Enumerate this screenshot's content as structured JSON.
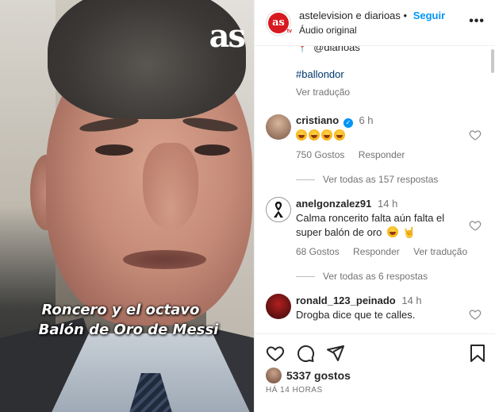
{
  "video": {
    "logo": "as",
    "caption_line1": "Roncero y el octavo",
    "caption_line2": "Balón de Oro de Messi"
  },
  "header": {
    "avatar_text": "as",
    "avatar_badge": "tv",
    "accounts": "astelevision e diarioas",
    "separator": "•",
    "follow": "Seguir",
    "audio": "Áudio original",
    "more": "•••"
  },
  "caption": {
    "tail": "@diarioas",
    "hashtag": "#ballondor",
    "translate": "Ver tradução"
  },
  "comments": [
    {
      "user": "cristiano",
      "verified": true,
      "time": "6 h",
      "text": "",
      "emoji_count": 4,
      "likes": "750 Gostos",
      "reply": "Responder",
      "translate": "",
      "view_replies": "Ver todas as 157 respostas"
    },
    {
      "user": "anelgonzalez91",
      "verified": false,
      "time": "14 h",
      "text": "Calma roncerito falta aún falta el super balón de oro",
      "likes": "68 Gostos",
      "reply": "Responder",
      "translate": "Ver tradução",
      "view_replies": "Ver todas as 6 respostas"
    },
    {
      "user": "ronald_123_peinado",
      "verified": false,
      "time": "14 h",
      "text": "Drogba dice que te calles.",
      "likes": "",
      "reply": "",
      "translate": ""
    }
  ],
  "footer": {
    "likes": "5337 gostos",
    "time_ago": "HÁ 14 HORAS"
  },
  "icons": {
    "like": "heart-icon",
    "comment": "comment-icon",
    "share": "share-icon",
    "save": "bookmark-icon",
    "more": "more-icon"
  },
  "colors": {
    "follow": "#0095f6",
    "hashtag": "#00376b",
    "muted": "#737373",
    "brand_red": "#d71920"
  }
}
